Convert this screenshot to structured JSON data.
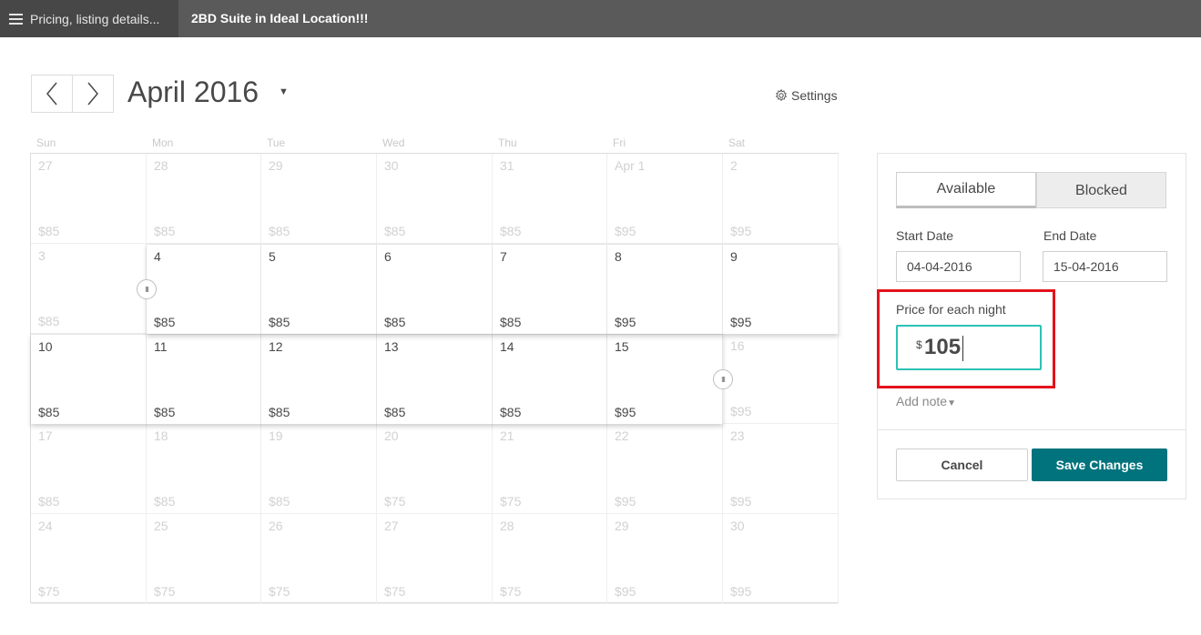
{
  "topbar": {
    "section_label": "Pricing, listing details...",
    "listing_title": "2BD Suite in Ideal Location!!!"
  },
  "header": {
    "month": "April 2016",
    "settings_label": "Settings"
  },
  "calendar": {
    "weekdays": [
      "Sun",
      "Mon",
      "Tue",
      "Wed",
      "Thu",
      "Fri",
      "Sat"
    ],
    "weeks": [
      [
        {
          "day": "27",
          "price": "$85",
          "active": false
        },
        {
          "day": "28",
          "price": "$85",
          "active": false
        },
        {
          "day": "29",
          "price": "$85",
          "active": false
        },
        {
          "day": "30",
          "price": "$85",
          "active": false
        },
        {
          "day": "31",
          "price": "$85",
          "active": false
        },
        {
          "day": "Apr 1",
          "price": "$95",
          "active": false
        },
        {
          "day": "2",
          "price": "$95",
          "active": false
        }
      ],
      [
        {
          "day": "3",
          "price": "$85",
          "active": false
        },
        {
          "day": "4",
          "price": "$85",
          "active": true
        },
        {
          "day": "5",
          "price": "$85",
          "active": true
        },
        {
          "day": "6",
          "price": "$85",
          "active": true
        },
        {
          "day": "7",
          "price": "$85",
          "active": true
        },
        {
          "day": "8",
          "price": "$95",
          "active": true
        },
        {
          "day": "9",
          "price": "$95",
          "active": true
        }
      ],
      [
        {
          "day": "10",
          "price": "$85",
          "active": true
        },
        {
          "day": "11",
          "price": "$85",
          "active": true
        },
        {
          "day": "12",
          "price": "$85",
          "active": true
        },
        {
          "day": "13",
          "price": "$85",
          "active": true
        },
        {
          "day": "14",
          "price": "$85",
          "active": true
        },
        {
          "day": "15",
          "price": "$95",
          "active": true
        },
        {
          "day": "16",
          "price": "$95",
          "active": false
        }
      ],
      [
        {
          "day": "17",
          "price": "$85",
          "active": false
        },
        {
          "day": "18",
          "price": "$85",
          "active": false
        },
        {
          "day": "19",
          "price": "$85",
          "active": false
        },
        {
          "day": "20",
          "price": "$75",
          "active": false
        },
        {
          "day": "21",
          "price": "$75",
          "active": false
        },
        {
          "day": "22",
          "price": "$95",
          "active": false
        },
        {
          "day": "23",
          "price": "$95",
          "active": false
        }
      ],
      [
        {
          "day": "24",
          "price": "$75",
          "active": false
        },
        {
          "day": "25",
          "price": "$75",
          "active": false
        },
        {
          "day": "26",
          "price": "$75",
          "active": false
        },
        {
          "day": "27",
          "price": "$75",
          "active": false
        },
        {
          "day": "28",
          "price": "$75",
          "active": false
        },
        {
          "day": "29",
          "price": "$95",
          "active": false
        },
        {
          "day": "30",
          "price": "$95",
          "active": false
        }
      ]
    ]
  },
  "panel": {
    "available_label": "Available",
    "blocked_label": "Blocked",
    "start_date_label": "Start Date",
    "start_date_value": "04-04-2016",
    "end_date_label": "End Date",
    "end_date_value": "15-04-2016",
    "price_label": "Price for each night",
    "currency_symbol": "$",
    "price_value": "105",
    "add_note_label": "Add note",
    "cancel_label": "Cancel",
    "save_label": "Save Changes"
  },
  "colors": {
    "topbar_bg": "#5a5a5a",
    "accent_teal": "#00737d",
    "input_focus": "#2bc2b4",
    "highlight_red": "#e4131b"
  }
}
